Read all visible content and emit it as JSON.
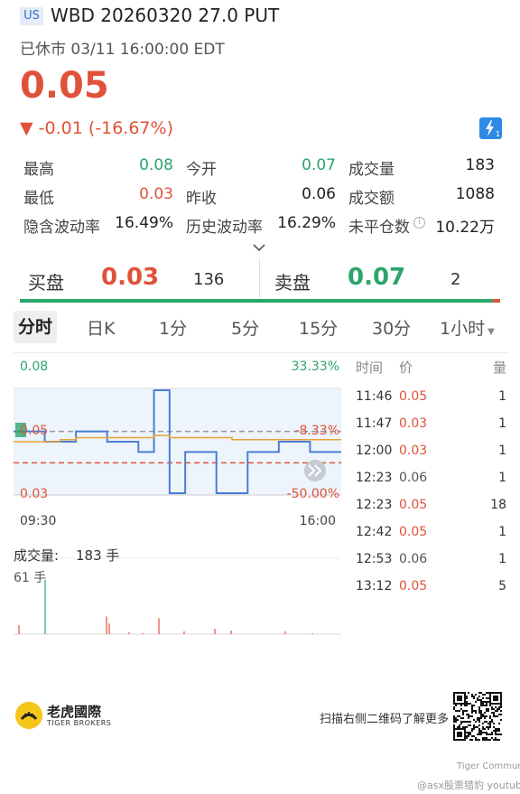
{
  "header": {
    "market_badge": "US",
    "title": "WBD 20260320 27.0 PUT",
    "status": "已休市 03/11 16:00:00 EDT",
    "price": "0.05",
    "change": "▼ -0.01 (-16.67%)"
  },
  "stats": [
    [
      {
        "label": "最高",
        "value": "0.08",
        "color": "up"
      },
      {
        "label": "今开",
        "value": "0.07",
        "color": "up"
      },
      {
        "label": "成交量",
        "value": "183",
        "color": ""
      }
    ],
    [
      {
        "label": "最低",
        "value": "0.03",
        "color": "down"
      },
      {
        "label": "昨收",
        "value": "0.06",
        "color": ""
      },
      {
        "label": "成交额",
        "value": "1088",
        "color": ""
      }
    ],
    [
      {
        "label": "隐含波动率",
        "value": "16.49%",
        "color": ""
      },
      {
        "label": "历史波动率",
        "value": "16.29%",
        "color": ""
      },
      {
        "label": "未平仓数",
        "value": "10.22万",
        "color": ""
      }
    ]
  ],
  "orderbook": {
    "bid_label": "买盘",
    "bid_price": "0.03",
    "bid_qty": "136",
    "ask_label": "卖盘",
    "ask_price": "0.07",
    "ask_qty": "2",
    "bid_ratio": 0.985
  },
  "tabs": [
    "分时",
    "日K",
    "1分",
    "5分",
    "15分",
    "30分",
    "1小时"
  ],
  "active_tab": "分时",
  "chart": {
    "y_high": "0.08",
    "y_high_pct": "33.33%",
    "y_mid": "0.05",
    "y_mid_pct": "-8.33%",
    "y_low": "0.03",
    "y_low_pct": "-50.00%",
    "x_start": "09:30",
    "x_end": "16:00",
    "volume_label": "成交量:",
    "volume_value": "183 手",
    "volume_max": "61 手"
  },
  "chart_data": {
    "type": "line",
    "title": "",
    "xlabel": "",
    "ylabel": "",
    "x_range": [
      "09:30",
      "16:00"
    ],
    "ylim": [
      0.03,
      0.08
    ],
    "prev_close": 0.06,
    "series": [
      {
        "values": [
          0.06,
          0.06,
          0.055,
          0.055,
          0.06,
          0.06,
          0.055,
          0.055,
          0.05,
          0.08,
          0.03,
          0.05,
          0.05,
          0.03,
          0.03,
          0.05,
          0.05,
          0.055,
          0.055,
          0.05,
          0.05,
          0.05
        ]
      },
      {
        "values": [
          0.055,
          0.055,
          0.055,
          0.056,
          0.057,
          0.057,
          0.057,
          0.057,
          0.057,
          0.058,
          0.057,
          0.057,
          0.057,
          0.057,
          0.056,
          0.056,
          0.056,
          0.056,
          0.056,
          0.056,
          0.056,
          0.056
        ]
      }
    ],
    "volume_max": 61
  },
  "trades": {
    "headers": [
      "时间",
      "价",
      "量"
    ],
    "rows": [
      {
        "time": "11:46",
        "price": "0.05",
        "qty": "1",
        "color": "down"
      },
      {
        "time": "11:47",
        "price": "0.03",
        "qty": "1",
        "color": "down"
      },
      {
        "time": "12:00",
        "price": "0.03",
        "qty": "1",
        "color": "down"
      },
      {
        "time": "12:23",
        "price": "0.06",
        "qty": "1",
        "color": ""
      },
      {
        "time": "12:23",
        "price": "0.05",
        "qty": "18",
        "color": "down"
      },
      {
        "time": "12:42",
        "price": "0.05",
        "qty": "1",
        "color": "down"
      },
      {
        "time": "12:53",
        "price": "0.06",
        "qty": "1",
        "color": ""
      },
      {
        "time": "13:12",
        "price": "0.05",
        "qty": "5",
        "color": "down"
      }
    ]
  },
  "footer": {
    "brand_cn": "老虎國際",
    "brand_en": "TIGER BROKERS",
    "scan_text": "扫描右侧二维码了解更多",
    "watermark": "@asx股票猎豹 youtube",
    "community": "Tiger Community"
  },
  "colors": {
    "up": "#2aa56b",
    "down": "#e0523a",
    "accent": "#2e8ae6"
  }
}
